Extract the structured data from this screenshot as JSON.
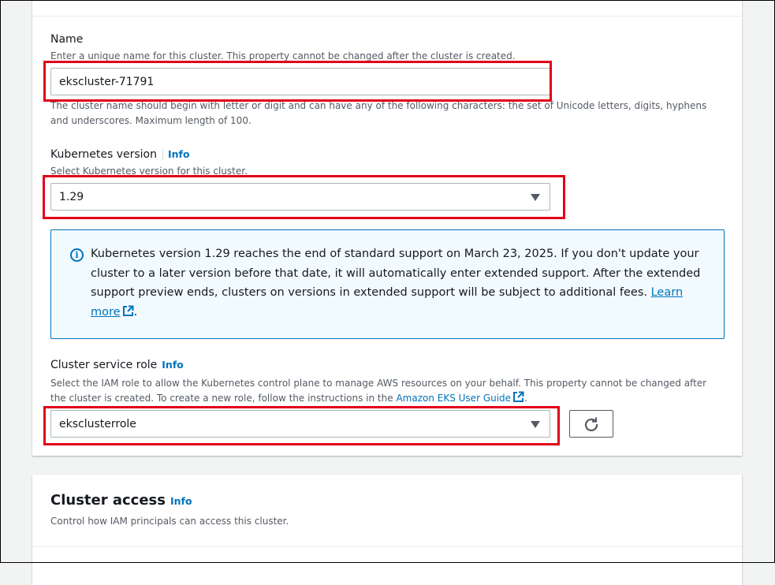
{
  "name_field": {
    "label": "Name",
    "description": "Enter a unique name for this cluster. This property cannot be changed after the cluster is created.",
    "value": "ekscluster-71791",
    "constraint_line1": "The cluster name should begin with letter or digit and can have any of the following characters: the set of Unicode letters, digits, hyphens",
    "constraint_line2": "and underscores. Maximum length of 100."
  },
  "k8s_version": {
    "label": "Kubernetes version",
    "info": "Info",
    "description": "Select Kubernetes version for this cluster.",
    "selected": "1.29"
  },
  "alert": {
    "text": "Kubernetes version 1.29 reaches the end of standard support on March 23, 2025. If you don't update your cluster to a later version before that date, it will automatically enter extended support. After the extended support preview ends, clusters on versions in extended support will be subject to additional fees.",
    "link_label": "Learn more",
    "trailing": "."
  },
  "service_role": {
    "label": "Cluster service role",
    "info": "Info",
    "description_line1": "Select the IAM role to allow the Kubernetes control plane to manage AWS resources on your behalf. This property cannot be changed after",
    "description_line2": "the cluster is created. To create a new role, follow the instructions in the",
    "guide_link": "Amazon EKS User Guide",
    "trailing": ".",
    "selected": "eksclusterrole"
  },
  "cluster_access": {
    "title": "Cluster access",
    "info": "Info",
    "description": "Control how IAM principals can access this cluster."
  },
  "colors": {
    "accent": "#0073bb",
    "highlight": "#e2001a",
    "alert_bg": "#f1faff"
  }
}
